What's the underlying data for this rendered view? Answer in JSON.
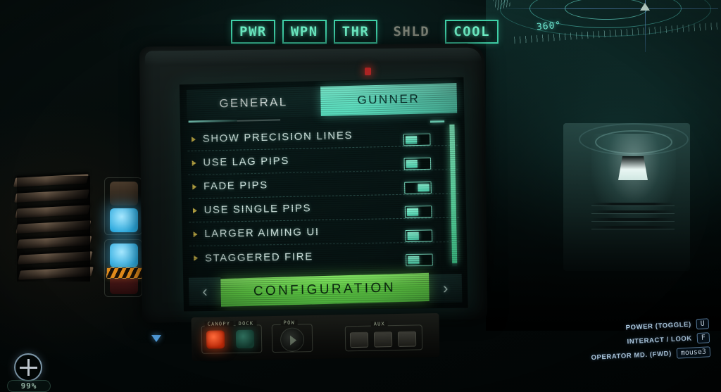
{
  "power_bar": {
    "buttons": [
      {
        "label": "PWR",
        "state": "on"
      },
      {
        "label": "WPN",
        "state": "on"
      },
      {
        "label": "THR",
        "state": "on"
      },
      {
        "label": "SHLD",
        "state": "off"
      },
      {
        "label": "COOL",
        "state": "on"
      }
    ]
  },
  "hud": {
    "degree_label": "360°"
  },
  "screen": {
    "tabs": [
      {
        "label": "GENERAL",
        "active": false
      },
      {
        "label": "GUNNER",
        "active": true
      }
    ],
    "options": [
      {
        "label": "SHOW PRECISION LINES",
        "toggle": "off"
      },
      {
        "label": "USE LAG PIPS",
        "toggle": "off"
      },
      {
        "label": "FADE PIPS",
        "toggle": "on"
      },
      {
        "label": "USE SINGLE PIPS",
        "toggle": "off"
      },
      {
        "label": "LARGER AIMING UI",
        "toggle": "off"
      },
      {
        "label": "STAGGERED FIRE",
        "toggle": "off"
      }
    ],
    "nav": {
      "prev_label": "‹",
      "title": "CONFIGURATION",
      "next_label": "›"
    }
  },
  "console_panel": {
    "groups": [
      {
        "label": "CANOPY"
      },
      {
        "label": "DOCK"
      },
      {
        "label": "POW"
      },
      {
        "label": "AUX"
      }
    ]
  },
  "health": {
    "percent_label": "99%"
  },
  "keybinds": [
    {
      "action": "POWER (TOGGLE)",
      "key": "U"
    },
    {
      "action": "INTERACT / LOOK",
      "key": "F"
    },
    {
      "action": "OPERATOR MD. (FWD)",
      "key": "mouse3"
    }
  ],
  "colors": {
    "accent_cyan": "#6ef0c6",
    "accent_green": "#69e24c",
    "active_tab_bg": "#63e3c4",
    "bullet": "#d8c24e",
    "inactive_text": "#7f8478",
    "key_hint": "#b3cfe6"
  }
}
